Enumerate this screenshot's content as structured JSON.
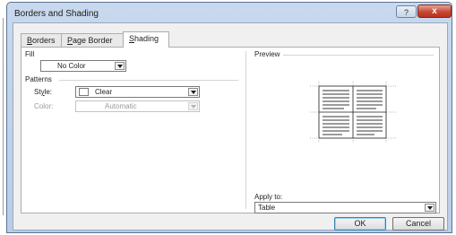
{
  "window": {
    "title": "Borders and Shading",
    "help_label": "?",
    "close_label": "x"
  },
  "tabs": [
    {
      "prefix": "",
      "mnemonic": "B",
      "rest": "orders"
    },
    {
      "prefix": "",
      "mnemonic": "P",
      "rest": "age Border"
    },
    {
      "prefix": "",
      "mnemonic": "S",
      "rest": "hading"
    }
  ],
  "fill": {
    "label": "Fill",
    "color_value": "No Color"
  },
  "patterns": {
    "label": "Patterns",
    "style_prefix": "St",
    "style_mnemonic": "y",
    "style_suffix": "le:",
    "style_value": "Clear",
    "color_label": "Color:",
    "color_value": "Automatic"
  },
  "preview": {
    "label": "Preview",
    "apply_prefix": "Apply to:",
    "apply_value": "Table"
  },
  "buttons": {
    "ok": "OK",
    "cancel": "Cancel"
  },
  "colors": {
    "title_bar": "#c8d9ee",
    "close_button": "#c74a33",
    "default_button_border": "#3c7fb1"
  }
}
